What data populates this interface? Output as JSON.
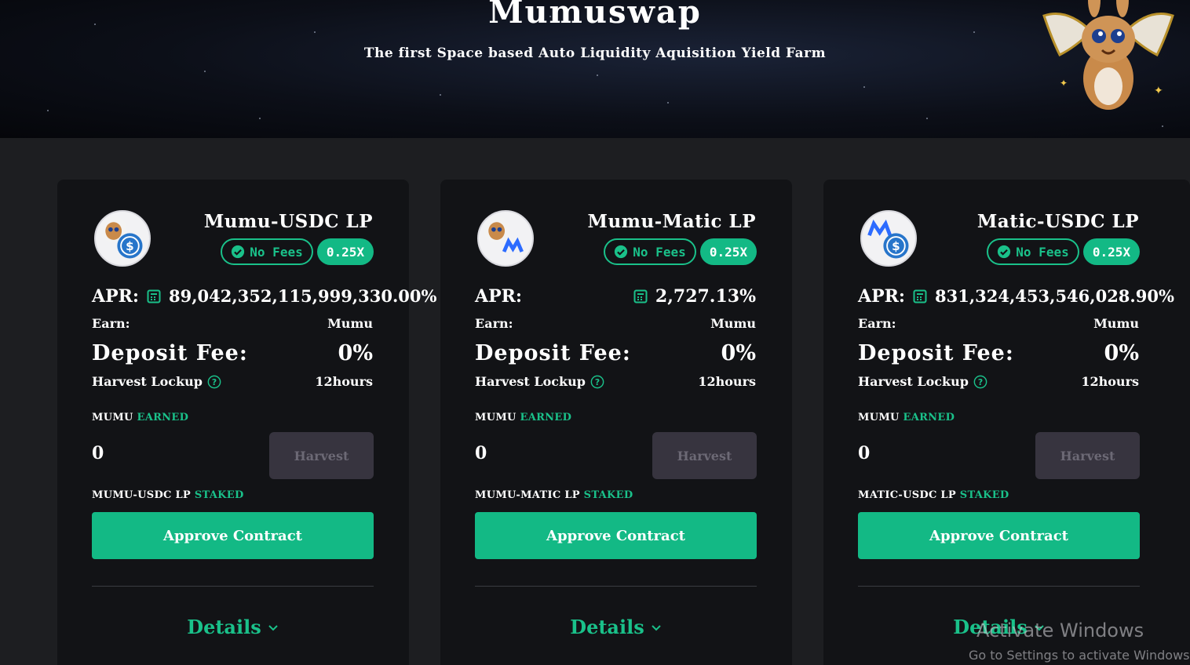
{
  "header": {
    "title": "Mumuswap",
    "subtitle": "The first Space based Auto Liquidity Aquisition Yield Farm"
  },
  "colors": {
    "accent": "#13b985",
    "card_bg": "#121316",
    "page_bg": "#1d1e21",
    "harvest_disabled": "#37343f"
  },
  "pools": [
    {
      "title": "Mumu-USDC LP",
      "badge_fees": "No Fees",
      "badge_multiplier": "0.25X",
      "apr_label": "APR:",
      "apr_value": "89,042,352,115,999,330.00%",
      "earn_label": "Earn:",
      "earn_value": "Mumu",
      "deposit_fee_label": "Deposit Fee:",
      "deposit_fee_value": "0%",
      "harvest_lockup_label": "Harvest Lockup",
      "harvest_lockup_value": "12hours",
      "earned_token": "MUMU",
      "earned_word": "EARNED",
      "earned_amount": "0",
      "harvest_label": "Harvest",
      "staked_token": "MUMU-USDC LP",
      "staked_word": "STAKED",
      "approve_label": "Approve Contract",
      "details_label": "Details"
    },
    {
      "title": "Mumu-Matic LP",
      "badge_fees": "No Fees",
      "badge_multiplier": "0.25X",
      "apr_label": "APR:",
      "apr_value": "2,727.13%",
      "earn_label": "Earn:",
      "earn_value": "Mumu",
      "deposit_fee_label": "Deposit Fee:",
      "deposit_fee_value": "0%",
      "harvest_lockup_label": "Harvest Lockup",
      "harvest_lockup_value": "12hours",
      "earned_token": "MUMU",
      "earned_word": "EARNED",
      "earned_amount": "0",
      "harvest_label": "Harvest",
      "staked_token": "MUMU-MATIC LP",
      "staked_word": "STAKED",
      "approve_label": "Approve Contract",
      "details_label": "Details"
    },
    {
      "title": "Matic-USDC LP",
      "badge_fees": "No Fees",
      "badge_multiplier": "0.25X",
      "apr_label": "APR:",
      "apr_value": "831,324,453,546,028.90%",
      "earn_label": "Earn:",
      "earn_value": "Mumu",
      "deposit_fee_label": "Deposit Fee:",
      "deposit_fee_value": "0%",
      "harvest_lockup_label": "Harvest Lockup",
      "harvest_lockup_value": "12hours",
      "earned_token": "MUMU",
      "earned_word": "EARNED",
      "earned_amount": "0",
      "harvest_label": "Harvest",
      "staked_token": "MATIC-USDC LP",
      "staked_word": "STAKED",
      "approve_label": "Approve Contract",
      "details_label": "Details"
    }
  ],
  "watermark": {
    "line1": "Activate Windows",
    "line2": "Go to Settings to activate Windows."
  }
}
